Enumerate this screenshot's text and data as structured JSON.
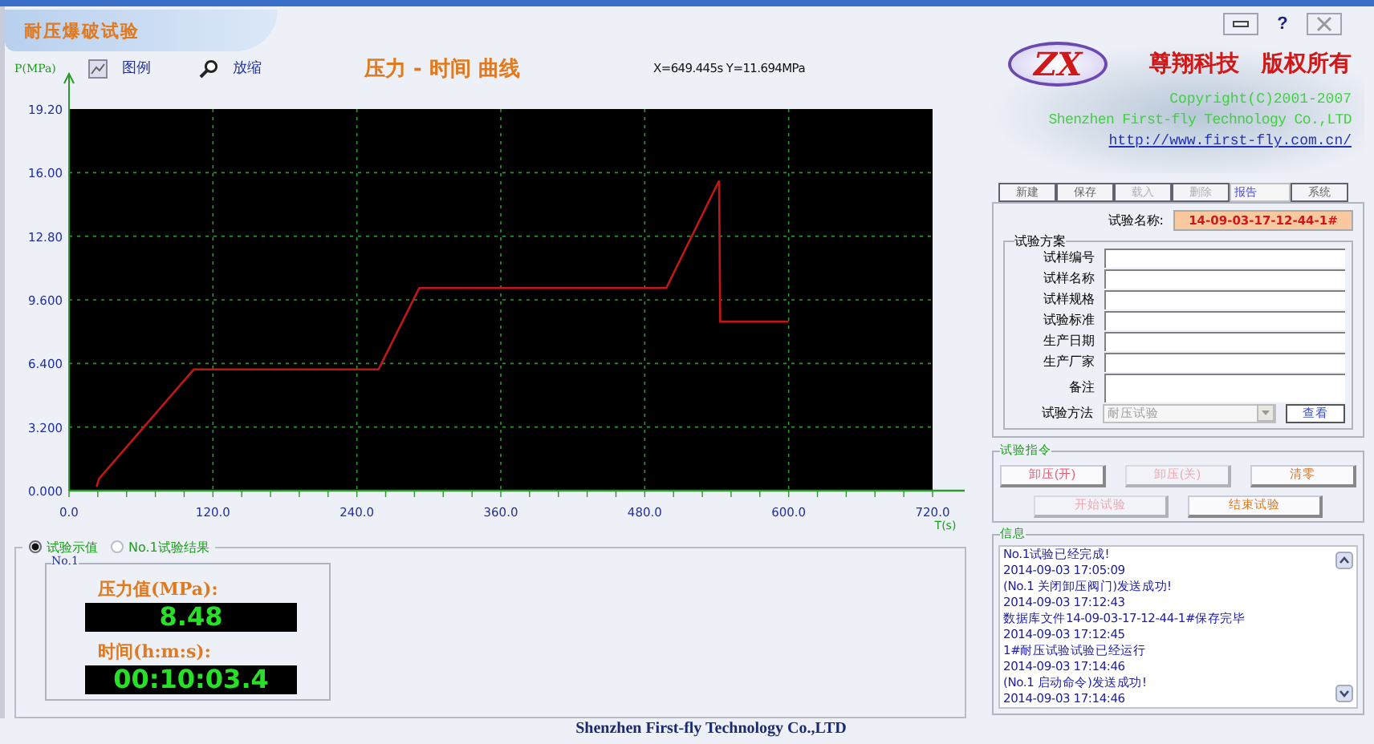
{
  "window": {
    "title": "耐压爆破试验",
    "help_button": "?"
  },
  "toolbar": {
    "legend": "图例",
    "zoom": "放缩",
    "chart_title": "压力 - 时间 曲线",
    "readout": "X=649.445s Y=11.694MPa"
  },
  "chart": {
    "chart_data": {
      "type": "line",
      "grid": true,
      "xlabel": "T(s)",
      "ylabel": "P(MPa)",
      "xlim": [
        0,
        720
      ],
      "ylim": [
        0,
        19.2
      ],
      "xticks": [
        {
          "value": 0,
          "label": "0.0"
        },
        {
          "value": 120,
          "label": "120.0"
        },
        {
          "value": 240,
          "label": "240.0"
        },
        {
          "value": 360,
          "label": "360.0"
        },
        {
          "value": 480,
          "label": "480.0"
        },
        {
          "value": 600,
          "label": "600.0"
        },
        {
          "value": 720,
          "label": "720.0"
        }
      ],
      "yticks": [
        {
          "value": 0,
          "label": "0.000"
        },
        {
          "value": 3.2,
          "label": "3.200"
        },
        {
          "value": 6.4,
          "label": "6.400"
        },
        {
          "value": 9.6,
          "label": "9.600"
        },
        {
          "value": 12.8,
          "label": "12.80"
        },
        {
          "value": 16,
          "label": "16.00"
        },
        {
          "value": 19.2,
          "label": "19.20"
        }
      ],
      "x": [
        23,
        25,
        104,
        258,
        292,
        380,
        498,
        542,
        543,
        600
      ],
      "series": [
        {
          "color": "#c01818",
          "values": [
            0.2,
            0.6,
            6.1,
            6.1,
            10.2,
            10.2,
            10.2,
            15.6,
            8.5,
            8.5
          ]
        }
      ]
    }
  },
  "display": {
    "tabs": [
      {
        "label": "试验示值",
        "selected": true
      },
      {
        "label": "No.1试验结果",
        "selected": false
      }
    ],
    "group": "No.1",
    "readings": [
      {
        "label": "压力值(MPa):",
        "value": "8.48"
      },
      {
        "label": "时间(h:m:s):",
        "value": "00:10:03.4"
      }
    ]
  },
  "brand": {
    "logo": "ZX",
    "company": "尊翔科技　版权所有",
    "copyright": "Copyright(C)2001-2007",
    "name": "Shenzhen First-fly Technology Co.,LTD",
    "url": "http://www.first-fly.com.cn/"
  },
  "menu_tabs": [
    {
      "label": "新建",
      "selected": false,
      "disabled": false
    },
    {
      "label": "保存",
      "selected": false,
      "disabled": false
    },
    {
      "label": "载入",
      "selected": false,
      "disabled": true
    },
    {
      "label": "删除",
      "selected": false,
      "disabled": true
    },
    {
      "label": "报告",
      "selected": true,
      "disabled": false
    },
    {
      "label": "系统",
      "selected": false,
      "disabled": false
    }
  ],
  "test_name": {
    "label": "试验名称:",
    "value": "14-09-03-17-12-44-1#"
  },
  "scheme": {
    "title": "试验方案",
    "fields": [
      {
        "label": "试样编号"
      },
      {
        "label": "试样名称"
      },
      {
        "label": "试样规格"
      },
      {
        "label": "试验标准"
      },
      {
        "label": "生产日期"
      },
      {
        "label": "生产厂家"
      },
      {
        "label": "备注"
      }
    ],
    "method": {
      "label": "试验方法",
      "value": "耐压试验"
    },
    "view_button": "查看"
  },
  "commands": {
    "title": "试验指令",
    "buttons": [
      {
        "label": "卸压(开)",
        "disabled": false,
        "color": "#e06070"
      },
      {
        "label": "卸压(关)",
        "disabled": true,
        "color": "#f0a8b0"
      },
      {
        "label": "清零",
        "disabled": false,
        "color": "#e07820"
      },
      {
        "label": "开始试验",
        "disabled": true,
        "color": "#f0a8b0"
      },
      {
        "label": "结束试验",
        "disabled": false,
        "color": "#e07820"
      }
    ]
  },
  "info": {
    "title": "信息",
    "messages": [
      "No.1试验已经完成!",
      "2014-09-03 17:05:09",
      "(No.1 关闭卸压阀门)发送成功!",
      "2014-09-03 17:12:43",
      "数据库文件14-09-03-17-12-44-1#保存完毕",
      "2014-09-03 17:12:45",
      "1#耐压试验试验已经运行",
      "2014-09-03 17:14:46",
      "(No.1 启动命令)发送成功!",
      "2014-09-03 17:14:46"
    ]
  },
  "footer": "Shenzhen First-fly Technology Co.,LTD"
}
